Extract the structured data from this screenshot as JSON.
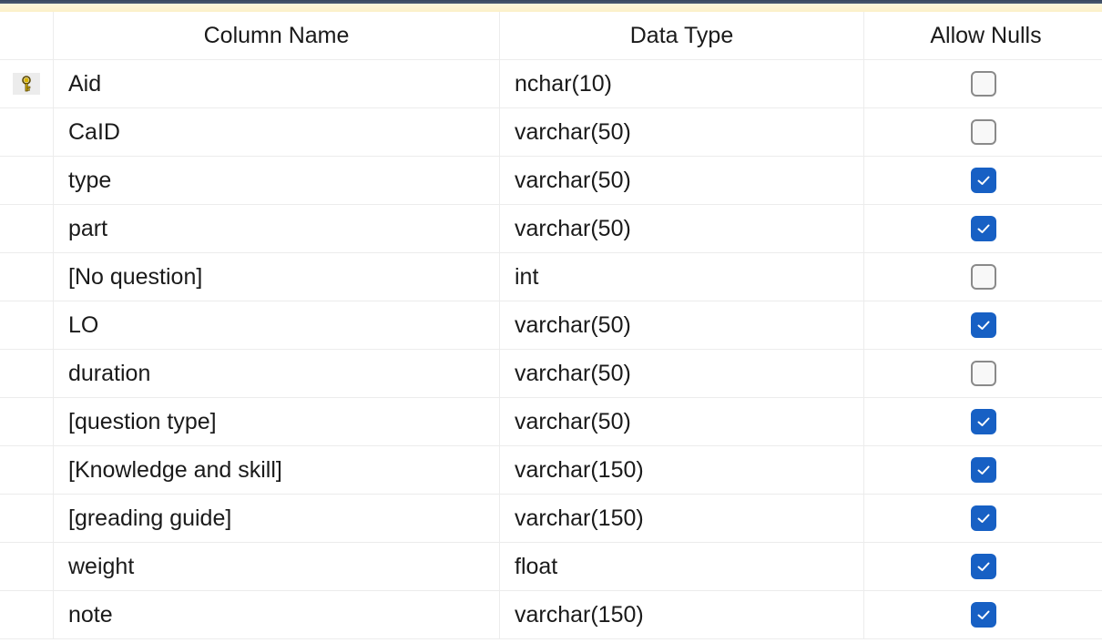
{
  "header": {
    "column_name": "Column Name",
    "data_type": "Data Type",
    "allow_nulls": "Allow Nulls"
  },
  "rows": [
    {
      "name": "Aid",
      "type": "nchar(10)",
      "allow_nulls": false,
      "primary_key": true
    },
    {
      "name": "CaID",
      "type": "varchar(50)",
      "allow_nulls": false
    },
    {
      "name": "type",
      "type": "varchar(50)",
      "allow_nulls": true
    },
    {
      "name": "part",
      "type": "varchar(50)",
      "allow_nulls": true
    },
    {
      "name": "[No question]",
      "type": "int",
      "allow_nulls": false
    },
    {
      "name": "LO",
      "type": "varchar(50)",
      "allow_nulls": true
    },
    {
      "name": "duration",
      "type": "varchar(50)",
      "allow_nulls": false
    },
    {
      "name": "[question type]",
      "type": "varchar(50)",
      "allow_nulls": true
    },
    {
      "name": "[Knowledge and skill]",
      "type": "varchar(150)",
      "allow_nulls": true
    },
    {
      "name": "[greading guide]",
      "type": "varchar(150)",
      "allow_nulls": true
    },
    {
      "name": "weight",
      "type": "float",
      "allow_nulls": true
    },
    {
      "name": "note",
      "type": "varchar(150)",
      "allow_nulls": true
    }
  ],
  "icons": {
    "primary_key": "key-icon",
    "check": "checkmark-icon"
  },
  "colors": {
    "checkbox_checked": "#1760c4",
    "key": "#d9b400"
  }
}
